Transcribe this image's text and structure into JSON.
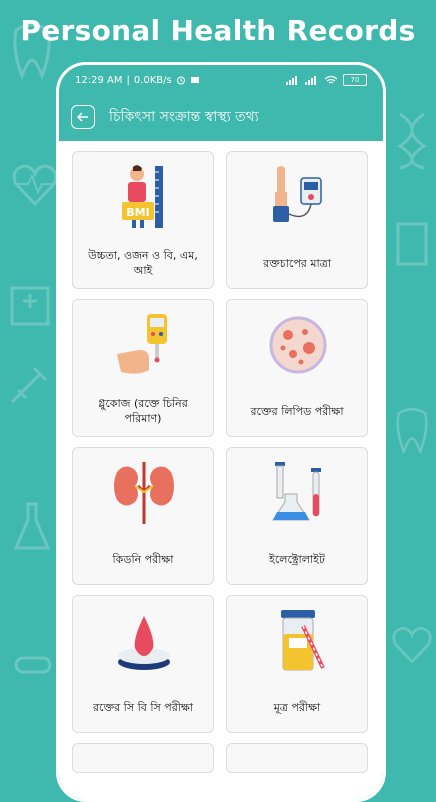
{
  "promo": {
    "title": "Personal Health Records"
  },
  "status_bar": {
    "time": "12:29 AM",
    "speed": "0.0KB/s",
    "battery": "70"
  },
  "app_bar": {
    "title": "চিকিৎসা সংক্রান্ত স্বাস্থ্য তথ্য"
  },
  "cards": [
    {
      "label": "উচ্চতা, ওজন ও বি, এম, আই",
      "icon": "bmi-icon",
      "icon_text": "BMI"
    },
    {
      "label": "রক্তচাপের মাত্রা",
      "icon": "blood-pressure-icon"
    },
    {
      "label": "গ্লুকোজ (রক্তে চিনির পরিমাণ)",
      "icon": "glucose-meter-icon"
    },
    {
      "label": "রক্তের লিপিড পরীক্ষা",
      "icon": "lipid-cell-icon"
    },
    {
      "label": "কিডনি পরীক্ষা",
      "icon": "kidney-icon"
    },
    {
      "label": "ইলেক্ট্রোলাইট",
      "icon": "test-tubes-icon"
    },
    {
      "label": "রক্তের সি বি সি পরীক্ষা",
      "icon": "blood-drop-icon"
    },
    {
      "label": "মূত্র পরীক্ষা",
      "icon": "urine-sample-icon"
    }
  ]
}
